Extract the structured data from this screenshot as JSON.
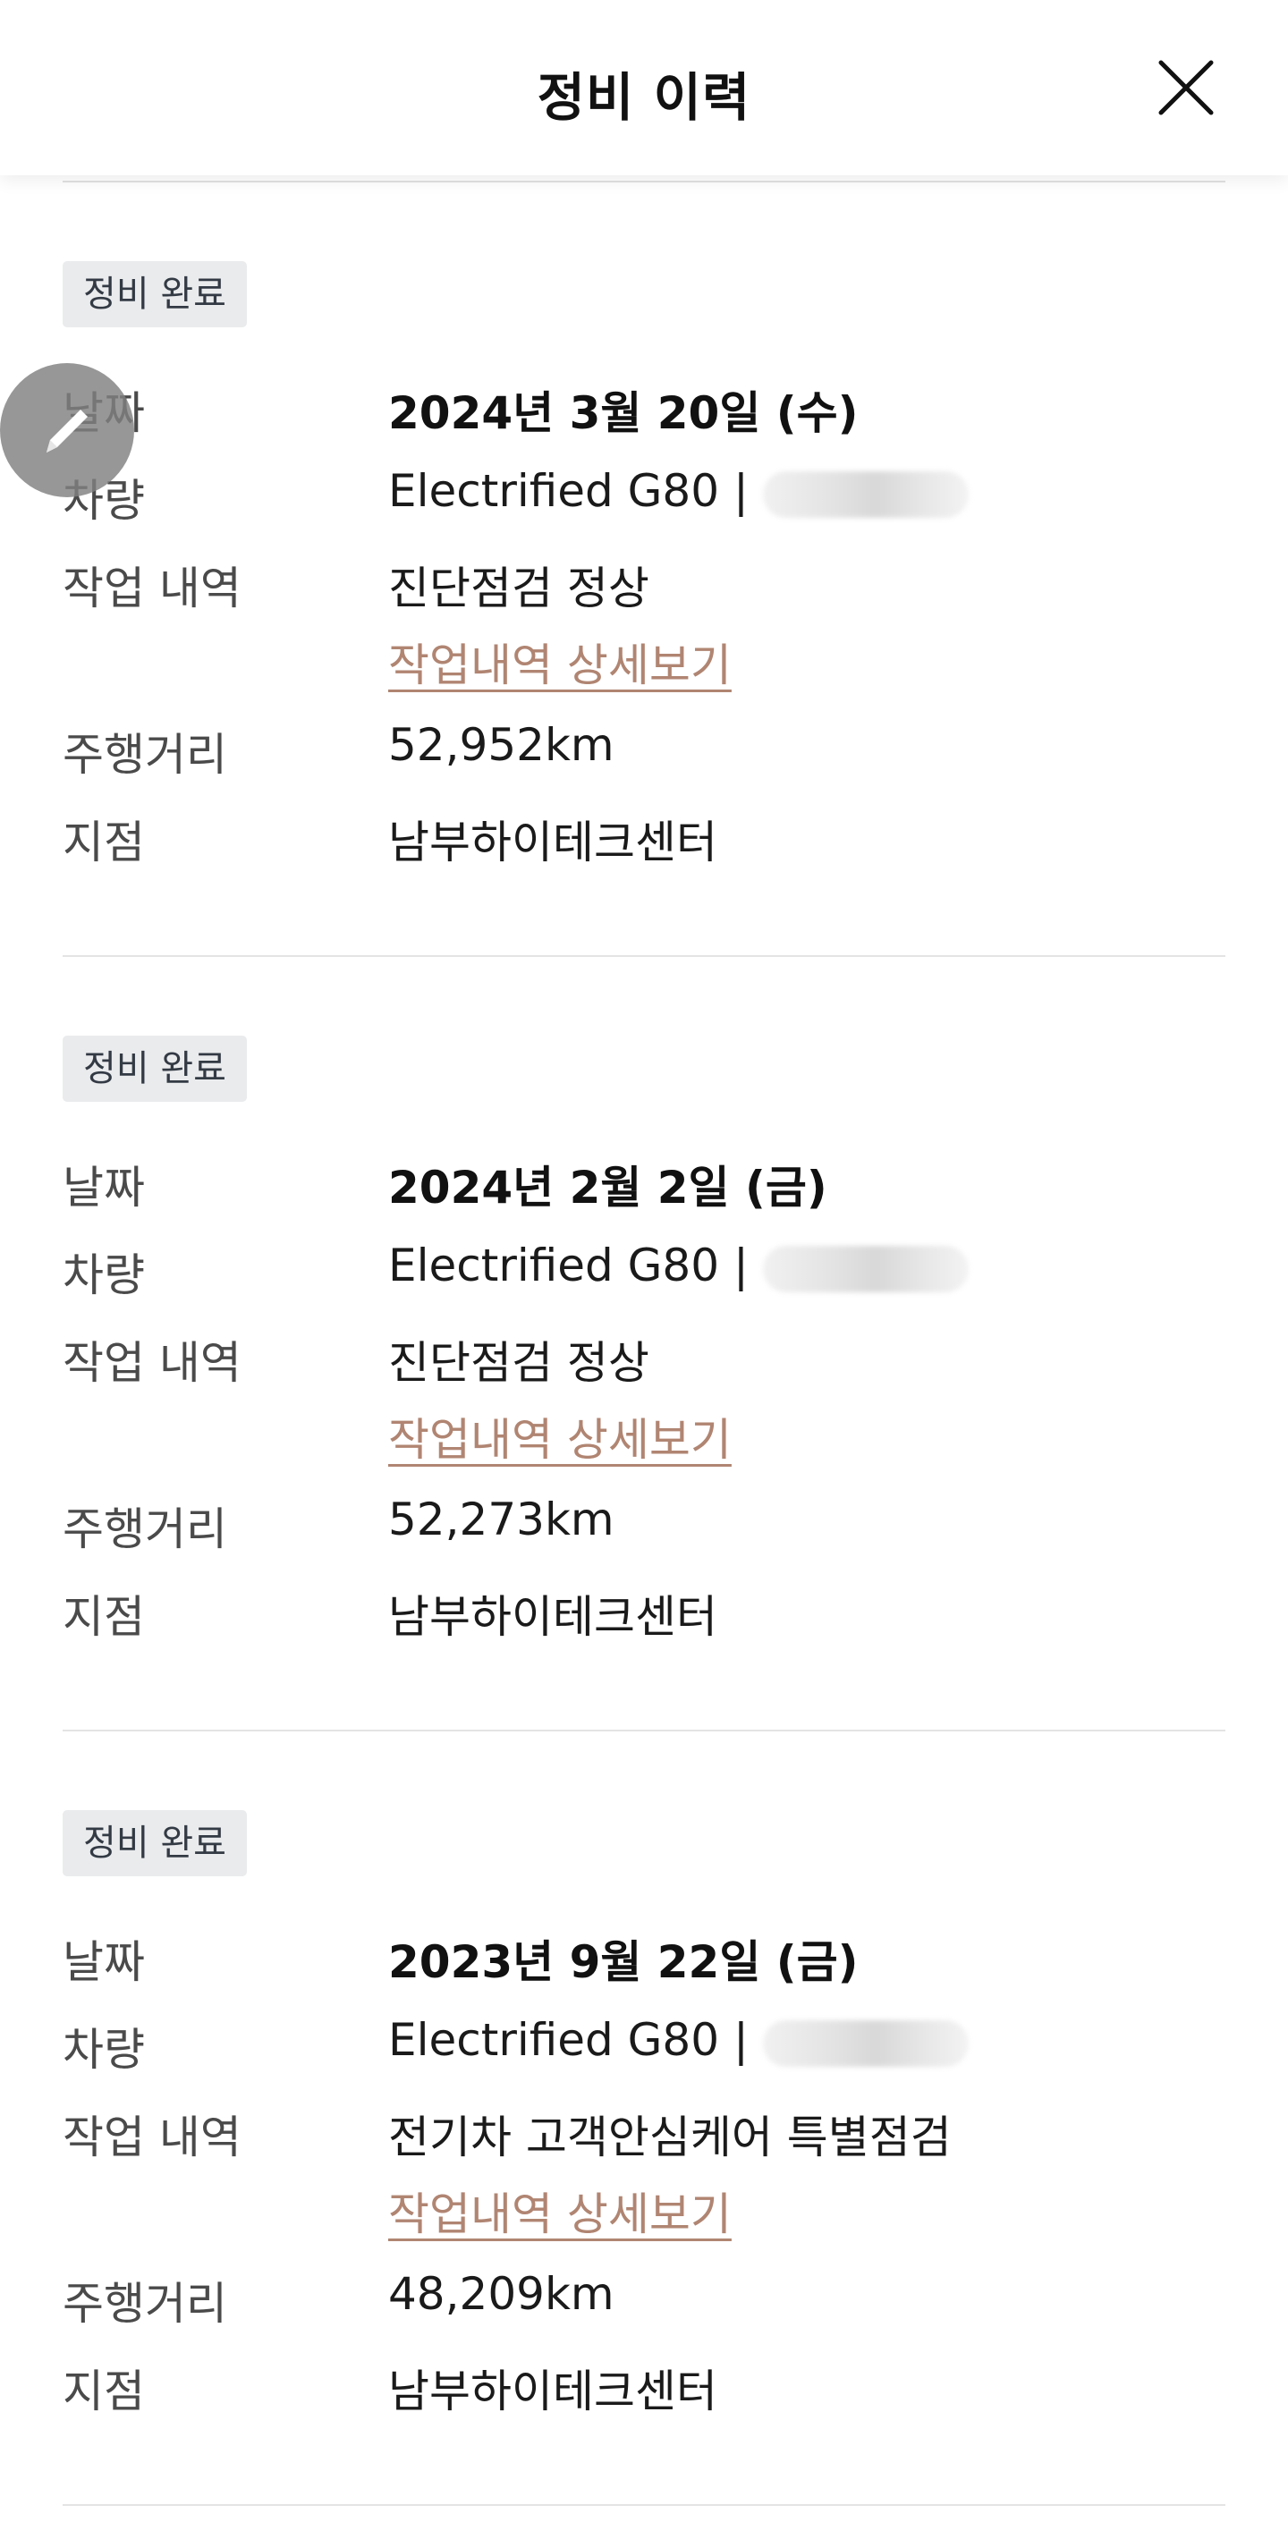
{
  "header": {
    "title": "정비 이력",
    "close_icon": "close-icon"
  },
  "records": [
    {
      "status": "정비 완료",
      "labels": {
        "date": "날짜",
        "vehicle": "차량",
        "work": "작업 내역",
        "mileage": "주행거리",
        "branch": "지점"
      },
      "date": "2024년 3월 20일 (수)",
      "vehicle_model": "Electrified G80",
      "vehicle_separator": "|",
      "work_desc": "진단점검 정상",
      "detail_link": "작업내역 상세보기",
      "mileage": "52,952km",
      "branch": "남부하이테크센터"
    },
    {
      "status": "정비 완료",
      "labels": {
        "date": "날짜",
        "vehicle": "차량",
        "work": "작업 내역",
        "mileage": "주행거리",
        "branch": "지점"
      },
      "date": "2024년 2월 2일 (금)",
      "vehicle_model": "Electrified G80",
      "vehicle_separator": "|",
      "work_desc": "진단점검 정상",
      "detail_link": "작업내역 상세보기",
      "mileage": "52,273km",
      "branch": "남부하이테크센터"
    },
    {
      "status": "정비 완료",
      "labels": {
        "date": "날짜",
        "vehicle": "차량",
        "work": "작업 내역",
        "mileage": "주행거리",
        "branch": "지점"
      },
      "date": "2023년 9월 22일 (금)",
      "vehicle_model": "Electrified G80",
      "vehicle_separator": "|",
      "work_desc": "전기차 고객안심케어 특별점검",
      "detail_link": "작업내역 상세보기",
      "mileage": "48,209km",
      "branch": "남부하이테크센터"
    }
  ],
  "fab": {
    "icon": "pencil-icon"
  },
  "colors": {
    "badge_bg": "#eaebed",
    "link": "#b08572",
    "divider": "#e4e4e4"
  }
}
